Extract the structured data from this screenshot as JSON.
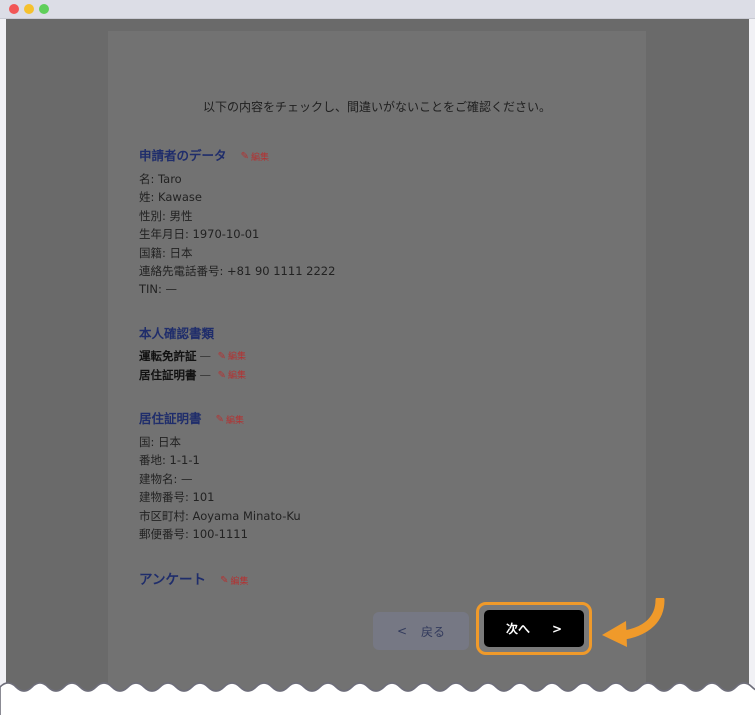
{
  "intro": "以下の内容をチェックし、間違いがないことをご確認ください。",
  "edit_label": "編集",
  "applicant": {
    "title": "申請者のデータ",
    "lines": [
      "名: Taro",
      "姓: Kawase",
      "性別: 男性",
      "生年月日: 1970-10-01",
      "国籍: 日本",
      "連絡先電話番号: +81 90 1111 2222",
      "TIN: —"
    ]
  },
  "identity": {
    "title": "本人確認書類",
    "docs": [
      {
        "name": "運転免許証",
        "dash": "—"
      },
      {
        "name": "居住証明書",
        "dash": "—"
      }
    ]
  },
  "residence": {
    "title": "居住証明書",
    "lines": [
      "国: 日本",
      "番地: 1-1-1",
      "建物名: —",
      "建物番号: 101",
      "市区町村: Aoyama Minato-Ku",
      "郵便番号: 100-1111"
    ]
  },
  "survey": {
    "title": "アンケート"
  },
  "buttons": {
    "back_chevron": "<",
    "back_label": "戻る",
    "next_label": "次へ",
    "next_chevron": ">"
  },
  "colors": {
    "section_title": "#1f2d6b",
    "edit": "#b33232",
    "highlight": "#f09a2a",
    "next_button": "#000000"
  }
}
